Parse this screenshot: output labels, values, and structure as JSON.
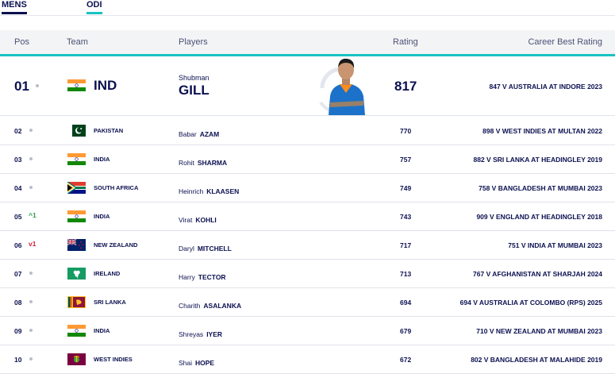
{
  "tabs": [
    {
      "label": "MENS"
    },
    {
      "label": "ODI"
    }
  ],
  "headers": {
    "pos": "Pos",
    "team": "Team",
    "players": "Players",
    "rating": "Rating",
    "best": "Career Best Rating"
  },
  "top": {
    "pos": "01",
    "team": "IND",
    "first": "Shubman",
    "last": "GILL",
    "rating": "817",
    "best": "847 V AUSTRALIA AT INDORE 2023"
  },
  "rows": [
    {
      "pos": "02",
      "move": "",
      "team": "PAKISTAN",
      "first": "Babar",
      "last": "AZAM",
      "rating": "770",
      "best": "898 V WEST INDIES AT MULTAN 2022",
      "flag": "pakistan"
    },
    {
      "pos": "03",
      "move": "",
      "team": "INDIA",
      "first": "Rohit",
      "last": "SHARMA",
      "rating": "757",
      "best": "882 V SRI LANKA AT HEADINGLEY 2019",
      "flag": "india"
    },
    {
      "pos": "04",
      "move": "",
      "team": "SOUTH AFRICA",
      "first": "Heinrich",
      "last": "KLAASEN",
      "rating": "749",
      "best": "758 V BANGLADESH AT MUMBAI 2023",
      "flag": "south-africa"
    },
    {
      "pos": "05",
      "move": "^1",
      "team": "INDIA",
      "first": "Virat",
      "last": "KOHLI",
      "rating": "743",
      "best": "909 V ENGLAND AT HEADINGLEY 2018",
      "flag": "india"
    },
    {
      "pos": "06",
      "move": "v1",
      "team": "NEW ZEALAND",
      "first": "Daryl",
      "last": "MITCHELL",
      "rating": "717",
      "best": "751 V INDIA AT MUMBAI 2023",
      "flag": "new-zealand"
    },
    {
      "pos": "07",
      "move": "",
      "team": "IRELAND",
      "first": "Harry",
      "last": "TECTOR",
      "rating": "713",
      "best": "767 V AFGHANISTAN AT SHARJAH 2024",
      "flag": "ireland"
    },
    {
      "pos": "08",
      "move": "",
      "team": "SRI LANKA",
      "first": "Charith",
      "last": "ASALANKA",
      "rating": "694",
      "best": "694 V AUSTRALIA AT COLOMBO (RPS) 2025",
      "flag": "sri-lanka"
    },
    {
      "pos": "09",
      "move": "",
      "team": "INDIA",
      "first": "Shreyas",
      "last": "IYER",
      "rating": "679",
      "best": "710 V NEW ZEALAND AT MUMBAI 2023",
      "flag": "india"
    },
    {
      "pos": "10",
      "move": "",
      "team": "WEST INDIES",
      "first": "Shai",
      "last": "HOPE",
      "rating": "672",
      "best": "802 V BANGLADESH AT MALAHIDE 2019",
      "flag": "west-indies"
    }
  ],
  "colors": {
    "accent": "#19c3c3",
    "navy": "#0b1050",
    "up": "#2aa14b",
    "down": "#d2213a"
  }
}
